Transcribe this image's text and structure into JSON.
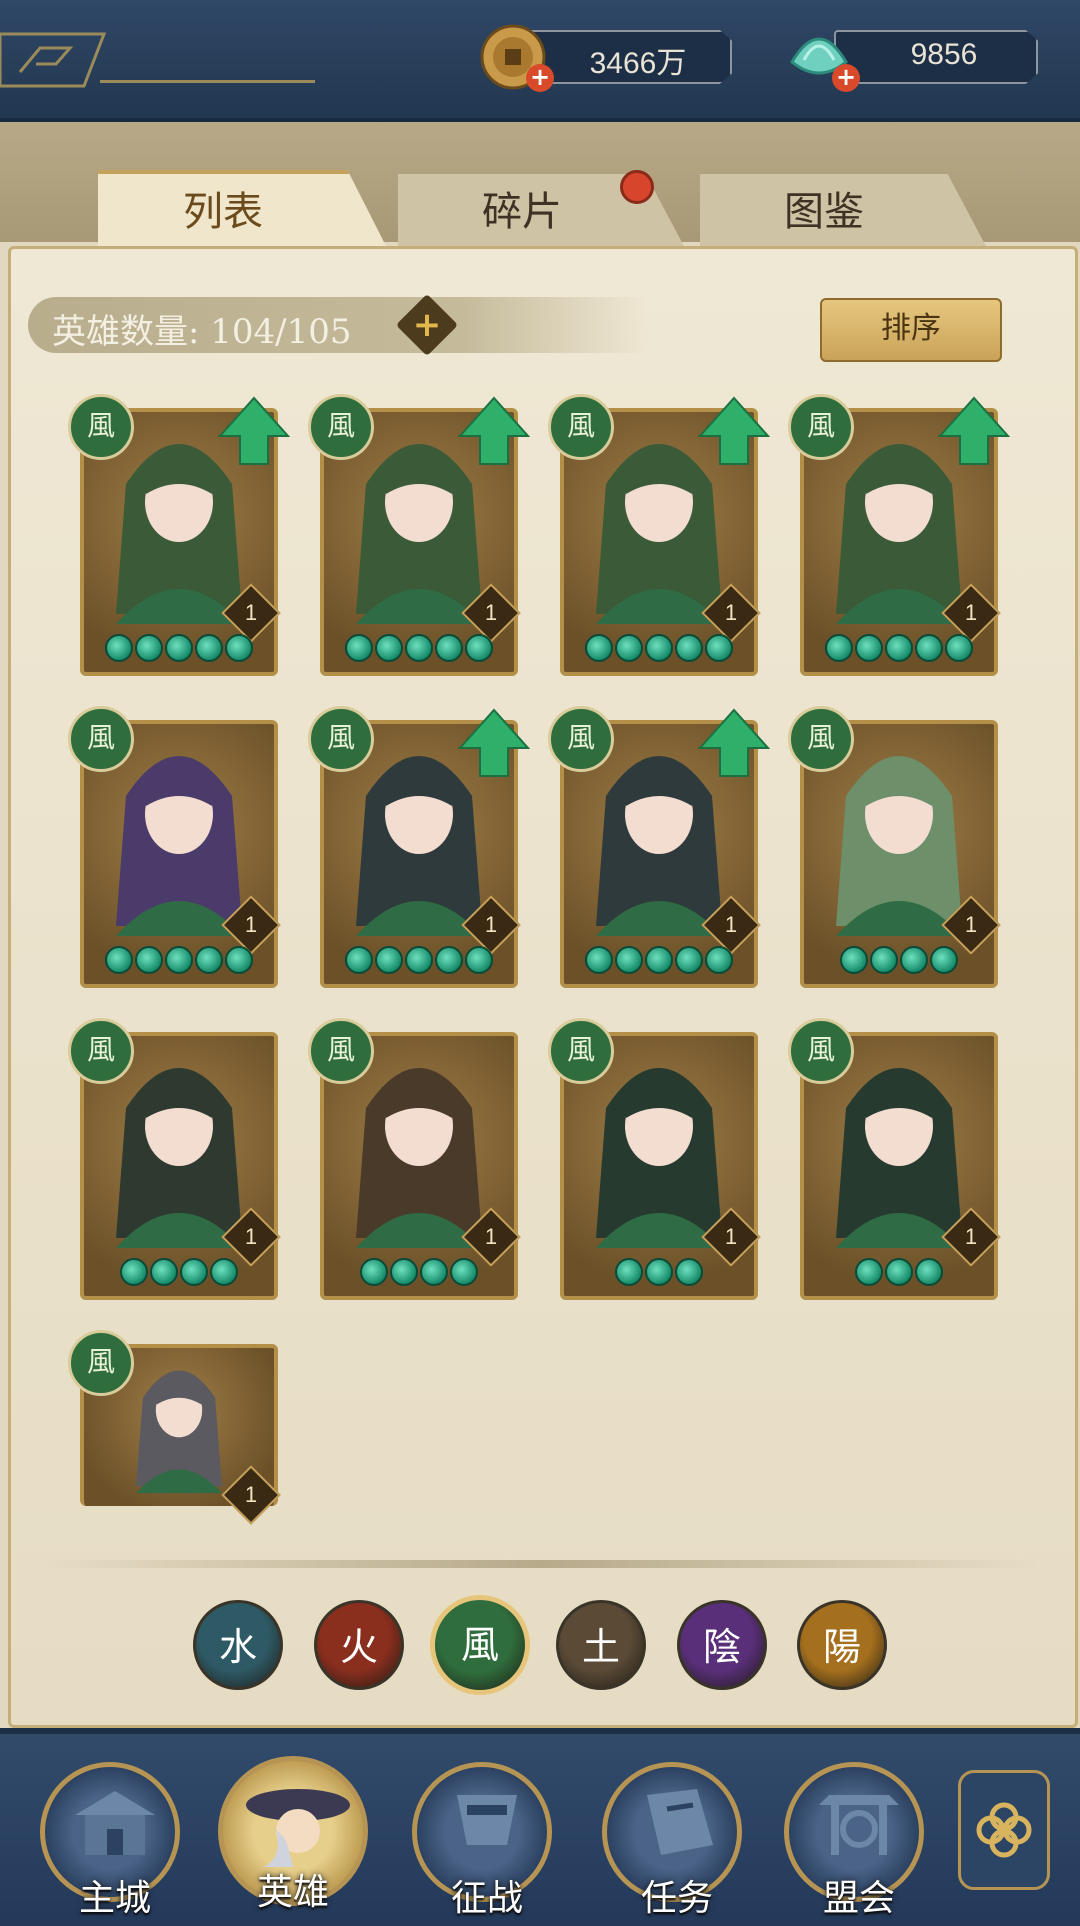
{
  "header": {
    "coins": {
      "value": "3466万",
      "icon": "copper-coin-icon"
    },
    "jade": {
      "value": "9856",
      "icon": "jade-shell-icon"
    }
  },
  "tabs": [
    {
      "label": "列表",
      "active": true
    },
    {
      "label": "碎片",
      "active": false,
      "has_badge": true
    },
    {
      "label": "图鉴",
      "active": false
    }
  ],
  "hero_count": {
    "text": "英雄数量: 104/105"
  },
  "sort_label": "排序",
  "heroes": [
    {
      "element": "風",
      "level": "1",
      "stars": 5,
      "upgrade": true
    },
    {
      "element": "風",
      "level": "1",
      "stars": 5,
      "upgrade": true
    },
    {
      "element": "風",
      "level": "1",
      "stars": 5,
      "upgrade": true
    },
    {
      "element": "風",
      "level": "1",
      "stars": 5,
      "upgrade": true
    },
    {
      "element": "風",
      "level": "1",
      "stars": 5,
      "upgrade": false
    },
    {
      "element": "風",
      "level": "1",
      "stars": 5,
      "upgrade": true
    },
    {
      "element": "風",
      "level": "1",
      "stars": 5,
      "upgrade": true
    },
    {
      "element": "風",
      "level": "1",
      "stars": 4,
      "upgrade": false
    },
    {
      "element": "風",
      "level": "1",
      "stars": 4,
      "upgrade": false
    },
    {
      "element": "風",
      "level": "1",
      "stars": 4,
      "upgrade": false
    },
    {
      "element": "風",
      "level": "1",
      "stars": 3,
      "upgrade": false
    },
    {
      "element": "風",
      "level": "1",
      "stars": 3,
      "upgrade": false
    },
    {
      "element": "風",
      "level": "1",
      "stars": 0,
      "upgrade": false
    }
  ],
  "element_filters": [
    {
      "glyph": "水",
      "color": "#2e5a66",
      "selected": false
    },
    {
      "glyph": "火",
      "color": "#8a2e1e",
      "selected": false
    },
    {
      "glyph": "風",
      "color": "#2f6d3c",
      "selected": true
    },
    {
      "glyph": "土",
      "color": "#5a4a36",
      "selected": false
    },
    {
      "glyph": "陰",
      "color": "#5a2f7a",
      "selected": false
    },
    {
      "glyph": "陽",
      "color": "#a5701e",
      "selected": false
    }
  ],
  "nav": [
    {
      "label": "主城",
      "icon": "main-city-icon",
      "active": false
    },
    {
      "label": "英雄",
      "icon": "hero-icon",
      "active": true
    },
    {
      "label": "征战",
      "icon": "campaign-icon",
      "active": false
    },
    {
      "label": "任务",
      "icon": "quest-icon",
      "active": false
    },
    {
      "label": "盟会",
      "icon": "guild-icon",
      "active": false
    }
  ]
}
